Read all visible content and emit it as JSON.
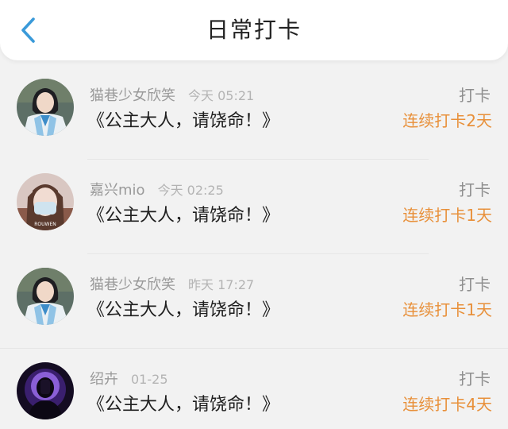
{
  "header": {
    "title": "日常打卡"
  },
  "entries": [
    {
      "nickname": "猫巷少女欣笑",
      "time": "今天 05:21",
      "book": "《公主大人，请饶命！》",
      "action": "打卡",
      "streak": "连续打卡2天"
    },
    {
      "nickname": "嘉兴mio",
      "time": "今天 02:25",
      "book": "《公主大人，请饶命！》",
      "action": "打卡",
      "streak": "连续打卡1天"
    },
    {
      "nickname": "猫巷少女欣笑",
      "time": "昨天 17:27",
      "book": "《公主大人，请饶命！》",
      "action": "打卡",
      "streak": "连续打卡1天"
    },
    {
      "nickname": "绍卉",
      "time": "01-25",
      "book": "《公主大人，请饶命！》",
      "action": "打卡",
      "streak": "连续打卡4天"
    }
  ],
  "colors": {
    "back_icon": "#3a9ad9",
    "streak": "#e8903a",
    "background": "#f2f2f2"
  },
  "icons": {
    "back": "chevron-left-icon"
  }
}
